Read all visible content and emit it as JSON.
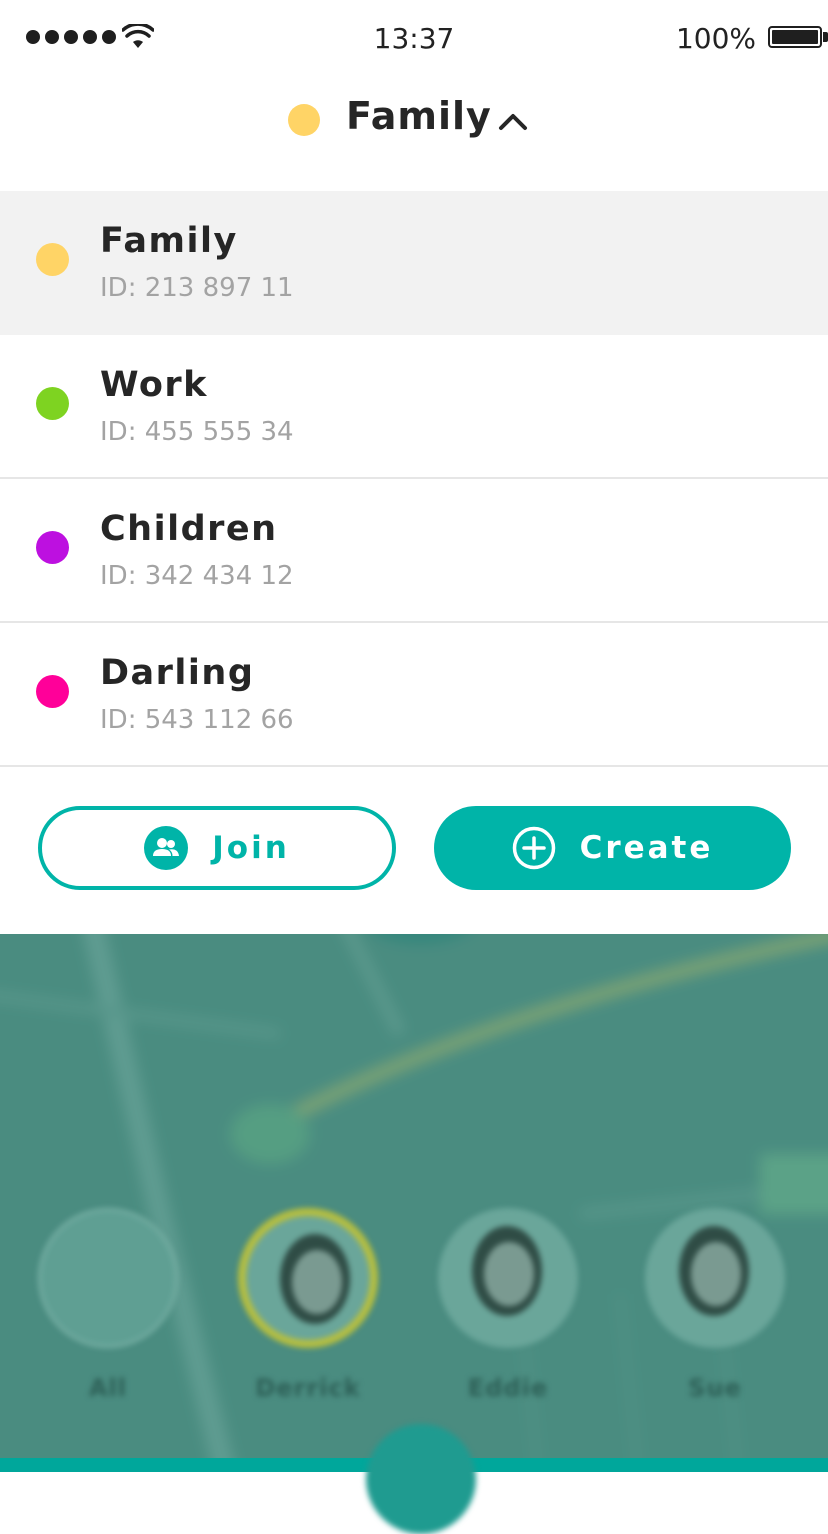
{
  "status_bar": {
    "time": "13:37",
    "battery": "100%",
    "signal_bars": 5,
    "wifi_icon": "wifi-icon",
    "battery_icon": "battery-icon"
  },
  "header": {
    "title": "Family",
    "dot_color": "#FFD466",
    "chevron_icon": "chevron-up-icon"
  },
  "groups": [
    {
      "name": "Family",
      "id_text": "ID: 213 897 11",
      "color": "#FFD466",
      "selected": true
    },
    {
      "name": "Work",
      "id_text": "ID: 455 555 34",
      "color": "#7ED321",
      "selected": false
    },
    {
      "name": "Children",
      "id_text": "ID: 342 434 12",
      "color": "#BD10E0",
      "selected": false
    },
    {
      "name": "Darling",
      "id_text": "ID: 543 112 66",
      "color": "#FF0099",
      "selected": false
    }
  ],
  "actions": {
    "join_label": "Join",
    "join_icon": "group-icon",
    "create_label": "Create",
    "create_icon": "plus-circle-icon"
  },
  "colors": {
    "accent": "#00B4A8",
    "selected_row_bg": "#F2F2F2"
  },
  "map_members": [
    {
      "name": "All"
    },
    {
      "name": "Derrick",
      "selected": true
    },
    {
      "name": "Eddie"
    },
    {
      "name": "Sue"
    }
  ]
}
